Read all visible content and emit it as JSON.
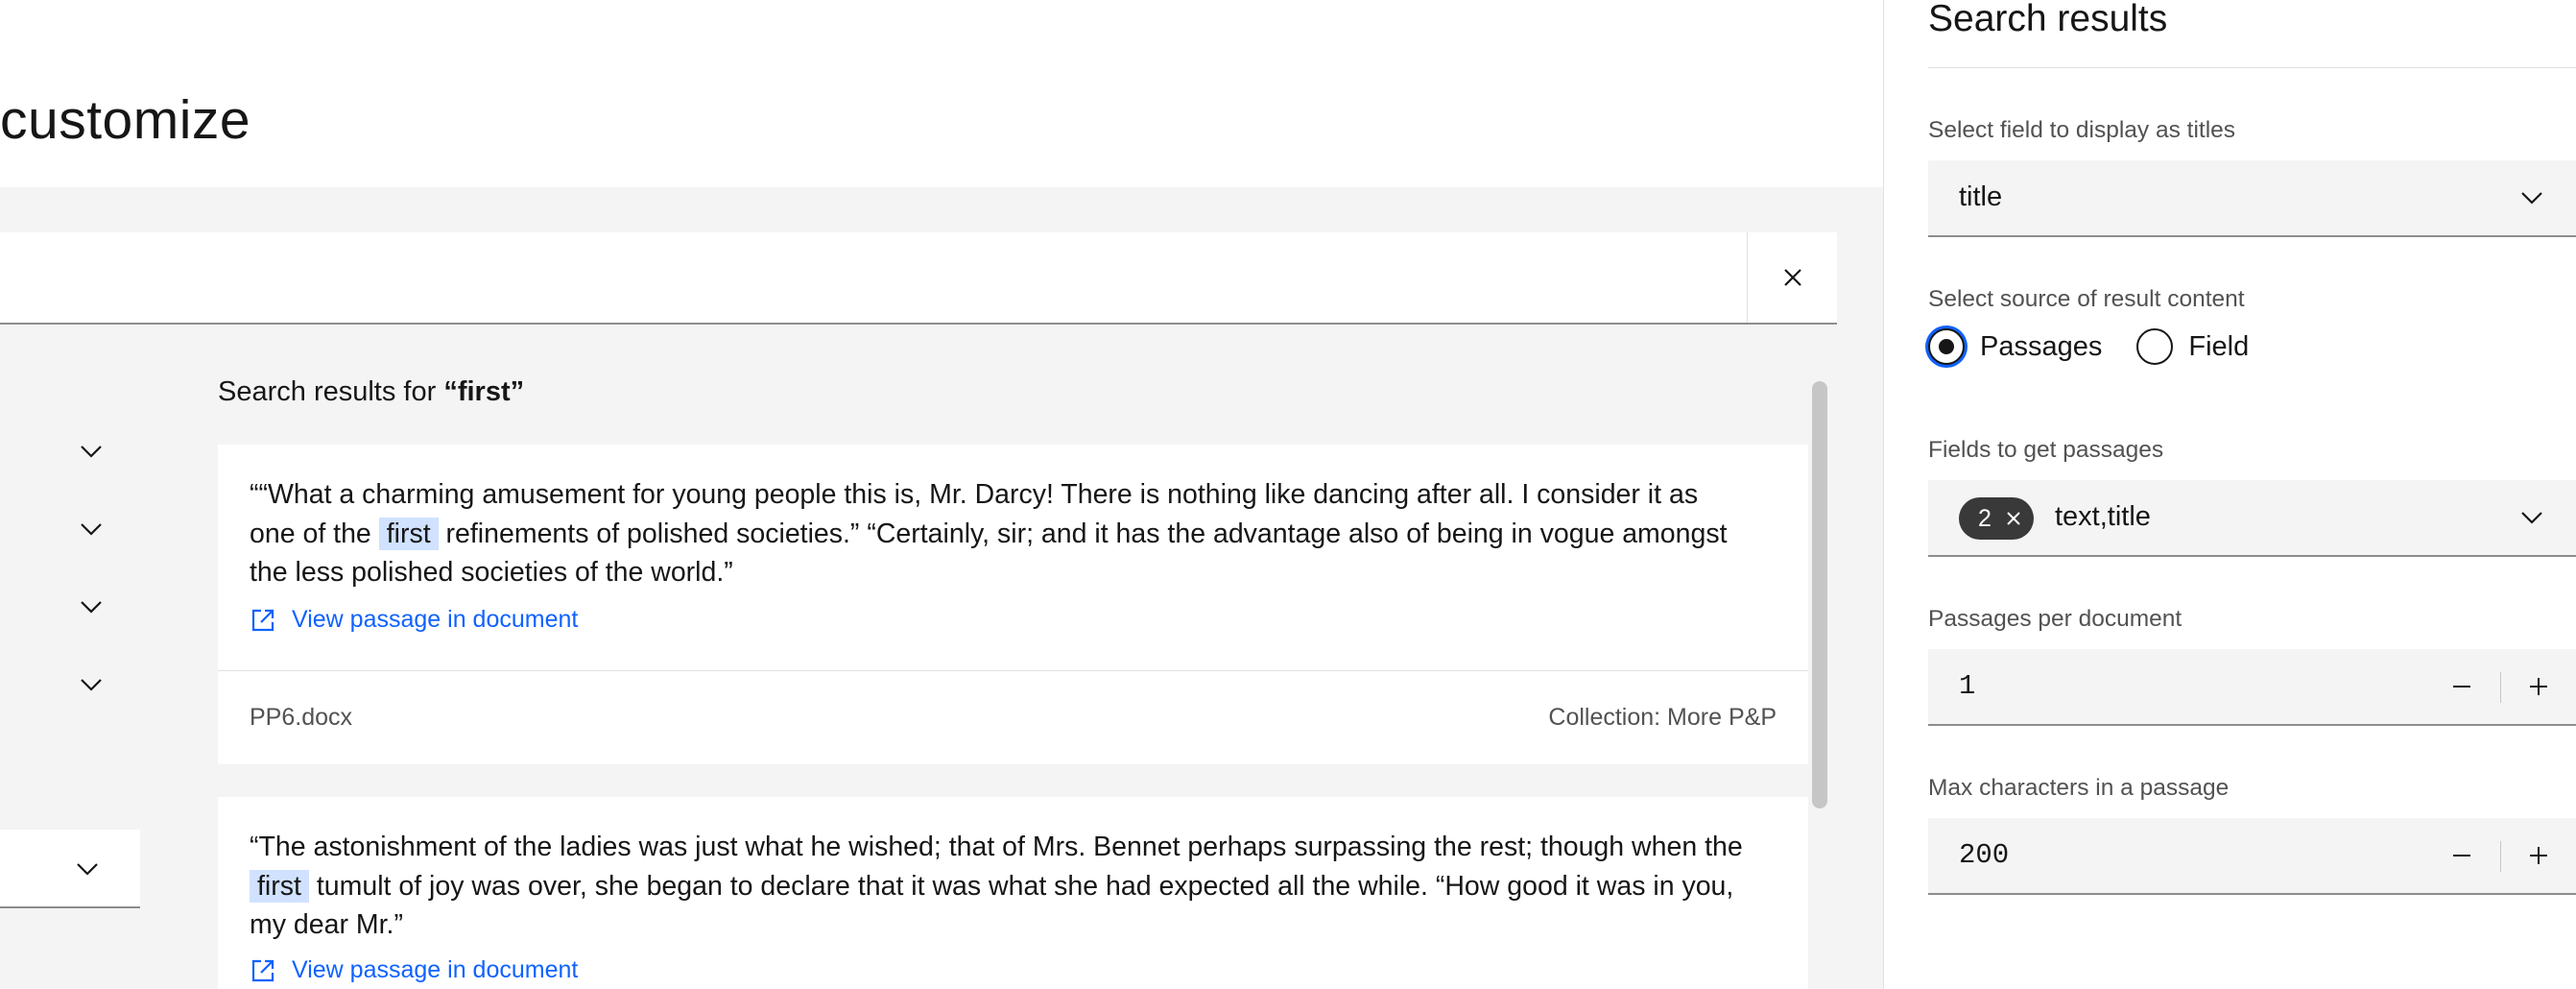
{
  "page": {
    "title": "customize"
  },
  "search": {
    "clear_icon": "close-icon"
  },
  "results": {
    "heading_prefix": "Search results for ",
    "query": "“first”",
    "cards": [
      {
        "text_before": "““What a charming amusement for young people this is, Mr. Darcy! There is nothing like dancing after all. I consider it as one of the ",
        "highlight": "first",
        "text_after": " refinements of polished societies.” “Certainly, sir; and it has the advantage also of being in vogue amongst the less polished societies of the world.”",
        "link_label": "View passage in document",
        "file": "PP6.docx",
        "collection": "Collection: More P&P"
      },
      {
        "text_before": "“The astonishment of the ladies was just what he wished; that of Mrs. Bennet perhaps surpassing the rest; though when the ",
        "highlight": "first",
        "text_after": " tumult of joy was over, she began to declare that it was what she had expected all the while. “How good it was in you, my dear Mr.”",
        "link_label": "View passage in document"
      }
    ]
  },
  "panel": {
    "title": "Search results",
    "title_field": {
      "label": "Select field to display as titles",
      "value": "title"
    },
    "source": {
      "label": "Select source of result content",
      "options": [
        "Passages",
        "Field"
      ],
      "selected": "Passages"
    },
    "passage_fields": {
      "label": "Fields to get passages",
      "count": "2",
      "value": "text,title"
    },
    "passages_per_doc": {
      "label": "Passages per document",
      "value": "1"
    },
    "max_chars": {
      "label": "Max characters in a passage",
      "value": "200"
    }
  },
  "colors": {
    "link": "#0f62fe",
    "highlight": "#d0e2ff",
    "focus": "#0f62fe",
    "tag": "#393939"
  }
}
